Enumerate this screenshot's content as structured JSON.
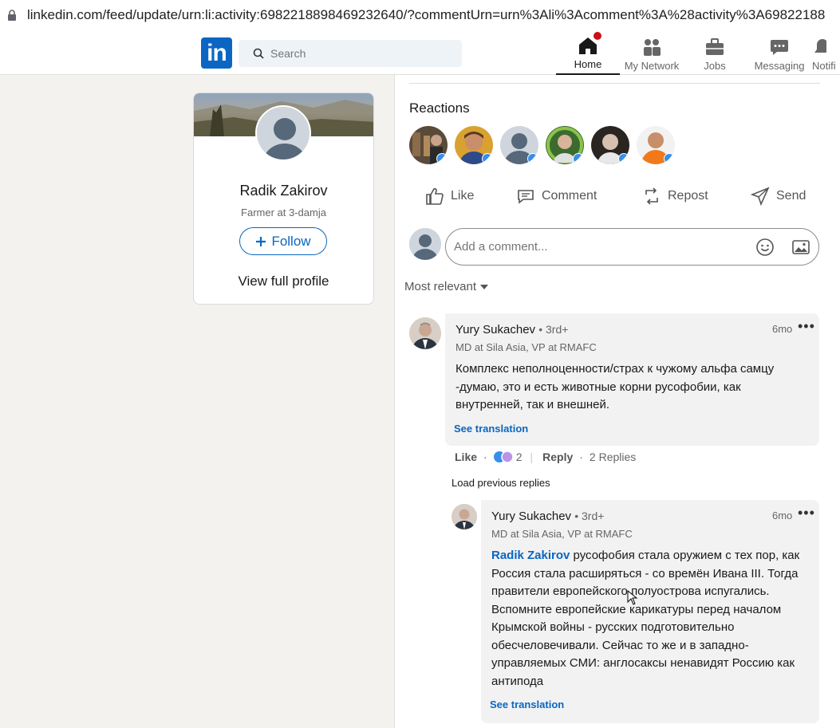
{
  "browser": {
    "url": "linkedin.com/feed/update/urn:li:activity:6982218898469232640/?commentUrn=urn%3Ali%3Acomment%3A%28activity%3A69822188"
  },
  "nav": {
    "logo": "in",
    "search_placeholder": "Search",
    "items": [
      {
        "label": "Home",
        "icon": "home-icon",
        "active": true
      },
      {
        "label": "My Network",
        "icon": "network-icon"
      },
      {
        "label": "Jobs",
        "icon": "briefcase-icon"
      },
      {
        "label": "Messaging",
        "icon": "messaging-icon"
      },
      {
        "label": "Notifi",
        "icon": "bell-icon"
      }
    ]
  },
  "profile_card": {
    "name": "Radik Zakirov",
    "headline": "Farmer at 3-damja",
    "follow_label": "Follow",
    "view_full_label": "View full profile"
  },
  "post": {
    "reactions_title": "Reactions",
    "actions": {
      "like": "Like",
      "comment": "Comment",
      "repost": "Repost",
      "send": "Send"
    },
    "comment_placeholder": "Add a comment...",
    "sort_label": "Most relevant"
  },
  "comments": [
    {
      "author": "Yury Sukachev",
      "degree": "• 3rd+",
      "headline": "MD at Sila Asia, VP at RMAFC",
      "time": "6mo",
      "text": "Комплекс неполноценности/страх к чужому альфа самцу -думаю, это и есть животные корни русофобии, как внутренней, так и внешней.",
      "see_translation": "See translation",
      "like_label": "Like",
      "reaction_count": "2",
      "reply_label": "Reply",
      "replies_label": "2 Replies"
    }
  ],
  "load_previous": "Load previous replies",
  "reply": {
    "author": "Yury Sukachev",
    "degree": "• 3rd+",
    "headline": "MD at Sila Asia, VP at RMAFC",
    "time": "6mo",
    "mention": "Radik Zakirov",
    "text": " русофобия стала оружием с тех пор, как Россия стала расширяться - со времён Ивана III. Тогда правители европейского полуострова испугались. Вспомните европейские карикатуры перед началом Крымской войны - русских подготовительно обесчеловечивали. Сейчас то же и в западно-управляемых СМИ: англосаксы ненавидят Россию как антипода",
    "see_translation": "See translation"
  },
  "colors": {
    "brand": "#0a66c2",
    "page_bg": "#f3f2ef",
    "notification_badge": "#cc1016"
  }
}
